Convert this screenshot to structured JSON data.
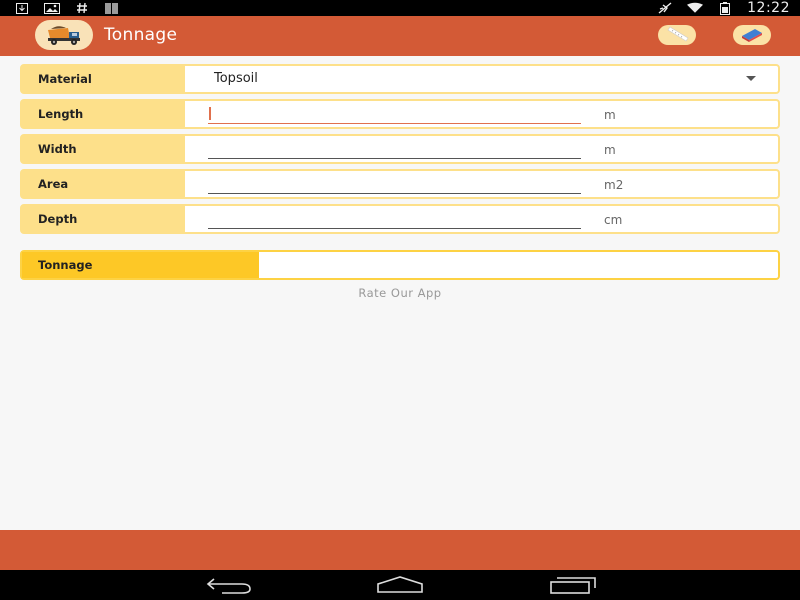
{
  "status_bar": {
    "time": "12:22",
    "left_icons": [
      "download-icon",
      "image-icon",
      "hash-icon",
      "barcode-icon"
    ],
    "right_icons": [
      "airplane-icon",
      "wifi-icon",
      "battery-icon"
    ]
  },
  "app_bar": {
    "title": "Tonnage",
    "logo_icon": "dump-truck-icon",
    "actions": [
      "ruler-icon",
      "eraser-icon"
    ]
  },
  "form": {
    "material": {
      "label": "Material",
      "value": "Topsoil"
    },
    "length": {
      "label": "Length",
      "value": "",
      "unit": "m"
    },
    "width": {
      "label": "Width",
      "value": "",
      "unit": "m"
    },
    "area": {
      "label": "Area",
      "value": "",
      "unit": "m2"
    },
    "depth": {
      "label": "Depth",
      "value": "",
      "unit": "cm"
    },
    "tonnage": {
      "label": "Tonnage",
      "value": ""
    }
  },
  "rate_link": "Rate Our App",
  "colors": {
    "primary": "#d35a36",
    "label_bg": "#fde08a",
    "result_bg": "#fdc826"
  }
}
